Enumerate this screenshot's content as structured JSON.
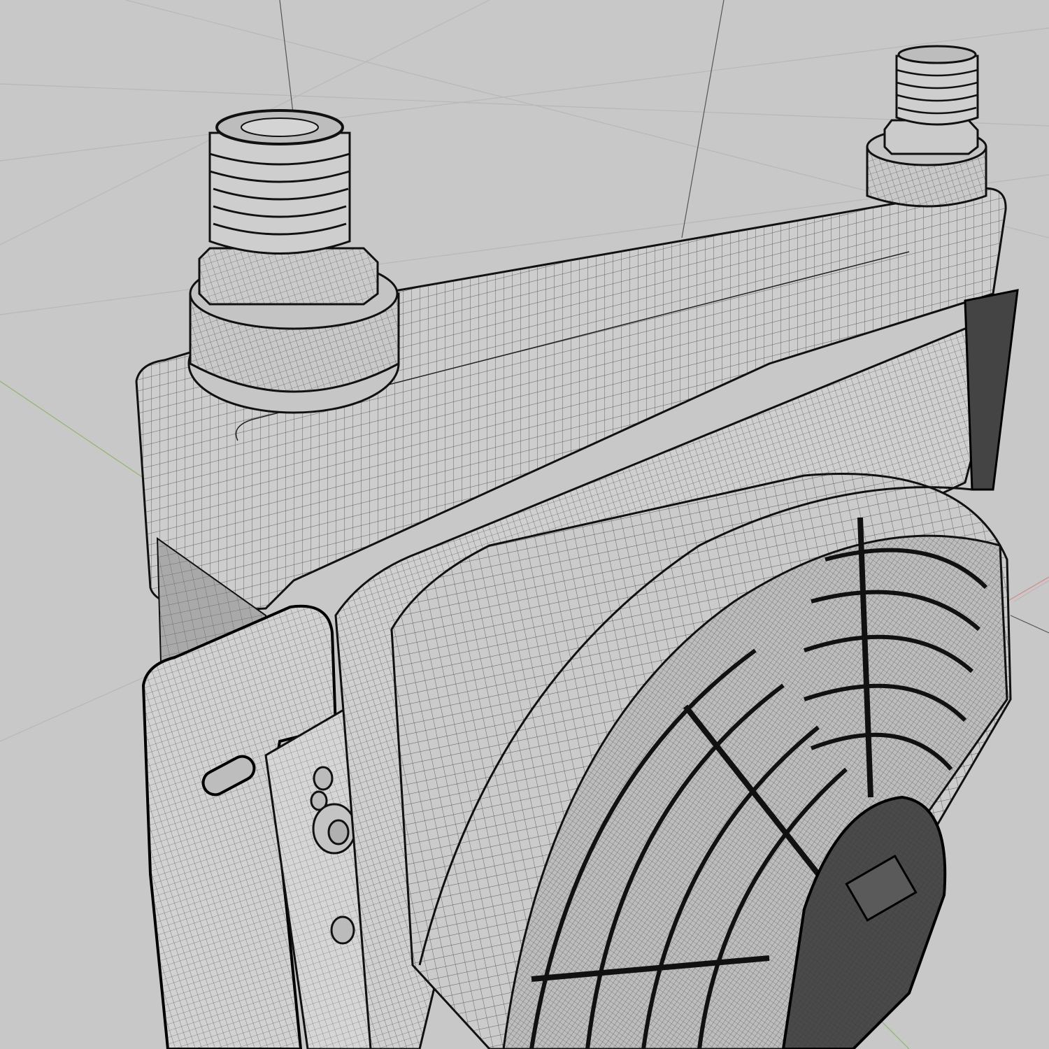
{
  "scene": {
    "background_color": "#c8c8c8",
    "grid_color": "#b9b9b9",
    "axis_x_color": "#d88888",
    "axis_y_color": "#8fb66d",
    "wire_color": "#1a1a1a",
    "surface_color": "#cfcfcf",
    "subject": "radiator-with-fan-wireframe-icon"
  }
}
